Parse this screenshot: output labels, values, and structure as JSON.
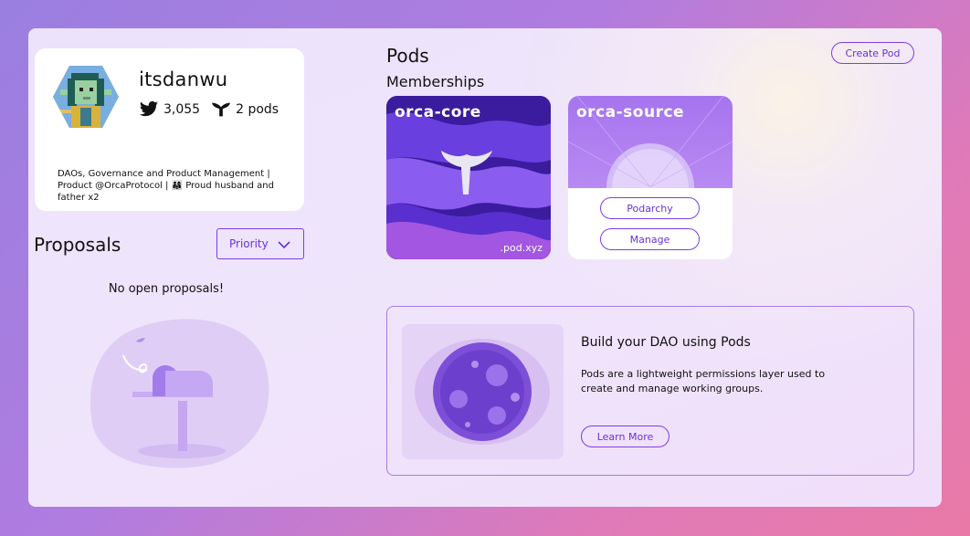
{
  "profile": {
    "username": "itsdanwu",
    "twitter_followers": "3,055",
    "pods_count": "2 pods",
    "bio": "DAOs, Governance and Product Management | Product @OrcaProtocol | 👨‍👩‍👧 Proud husband and father x2"
  },
  "proposals": {
    "title": "Proposals",
    "sort_selected": "Priority",
    "empty_message": "No open proposals!"
  },
  "pods": {
    "title": "Pods",
    "create_label": "Create Pod",
    "memberships_title": "Memberships",
    "cards": [
      {
        "name": "orca-core",
        "watermark": ".pod.xyz"
      },
      {
        "name": "orca-source",
        "buttons": [
          "Podarchy",
          "Manage"
        ]
      }
    ]
  },
  "promo": {
    "title": "Build your DAO using Pods",
    "body": "Pods are a lightweight permissions layer used to create and manage working groups.",
    "cta": "Learn More"
  },
  "colors": {
    "accent": "#7b3fe4",
    "accent_text": "#6a32d6",
    "card_bg": "#ffffff"
  },
  "icons": [
    "twitter-icon",
    "orca-tail-icon",
    "chevron-down-icon",
    "mailbox-illustration"
  ]
}
